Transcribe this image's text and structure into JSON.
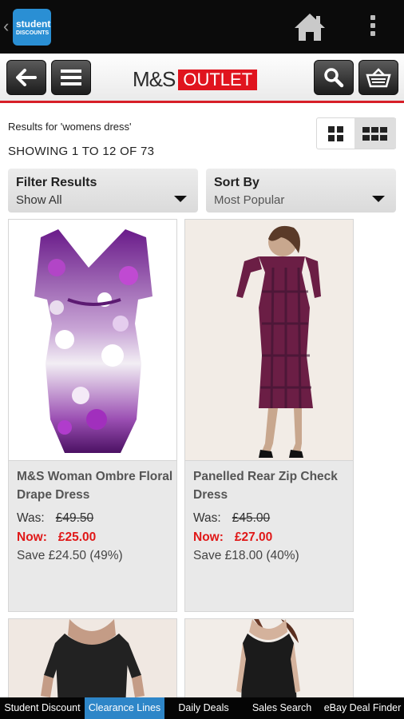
{
  "app": {
    "logo_line1": "student",
    "logo_line2": "DISCOUNTS"
  },
  "brand": {
    "name": "M&S",
    "outlet": "OUTLET"
  },
  "search": {
    "results_for": "Results for 'womens dress'",
    "showing": "SHOWING 1 TO 12 OF 73"
  },
  "filter": {
    "label": "Filter Results",
    "value": "Show All"
  },
  "sort": {
    "label": "Sort By",
    "value": "Most Popular"
  },
  "products": [
    {
      "name": "M&S Woman Ombre Floral Drape Dress",
      "was_label": "Was:",
      "was": "£49.50",
      "now_label": "Now:",
      "now": "£25.00",
      "save": "Save £24.50 (49%)"
    },
    {
      "name": "Panelled Rear Zip Check Dress",
      "was_label": "Was:",
      "was": "£45.00",
      "now_label": "Now:",
      "now": "£27.00",
      "save": "Save £18.00 (40%)"
    }
  ],
  "tabs": [
    {
      "label": "Student Discount"
    },
    {
      "label": "Clearance Lines"
    },
    {
      "label": "Daily Deals"
    },
    {
      "label": "Sales Search"
    },
    {
      "label": "eBay Deal Finder"
    }
  ],
  "colors": {
    "accent_red": "#e0141e",
    "price_red": "#e01818",
    "active_tab": "#2e86c8",
    "appbar": "#0b0b0b"
  }
}
